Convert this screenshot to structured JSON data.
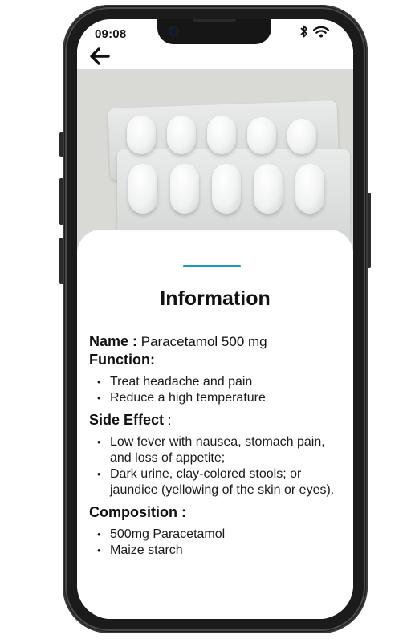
{
  "status_bar": {
    "time": "09:08",
    "icons": [
      "bluetooth-icon",
      "wifi-icon"
    ]
  },
  "nav": {
    "back_icon": "back-arrow-icon"
  },
  "info": {
    "title": "Information",
    "name_label": "Name :",
    "name_value": "Paracetamol 500 mg",
    "function_label": "Function:",
    "function_items": [
      "Treat headache and pain",
      "Reduce a high temperature"
    ],
    "side_effect_label": "Side Effect",
    "side_effect_colon": " :",
    "side_effect_items": [
      "Low fever with nausea, stomach pain, and loss of appetite;",
      "Dark urine, clay-colored stools; or jaundice (yellowing of the skin or eyes)."
    ],
    "composition_label": "Composition :",
    "composition_items": [
      "500mg Paracetamol",
      "Maize starch"
    ]
  },
  "colors": {
    "accent_handle": "#1a9bb8",
    "phone_frame": "#1b1b1b"
  }
}
